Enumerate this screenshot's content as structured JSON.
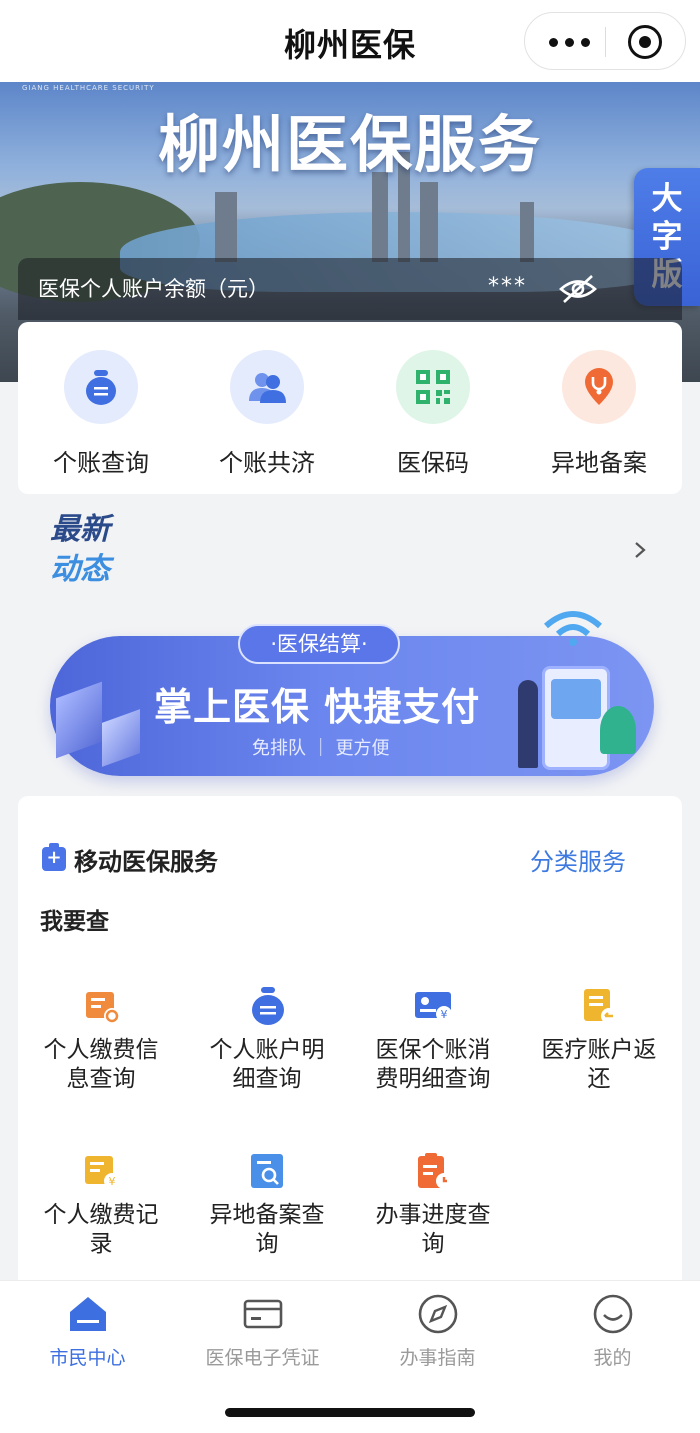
{
  "nav": {
    "title": "柳州医保"
  },
  "banner": {
    "tiny_text": "GIANG HEALTHCARE SECURITY",
    "title": "柳州医保服务",
    "big_font": [
      "大",
      "字",
      "版"
    ],
    "balance_label": "医保个人账户余额（元）",
    "balance_value": "***"
  },
  "quick_actions": [
    {
      "label": "个账查询",
      "icon": "money-bag-icon",
      "bg": "#e3ebfd",
      "color": "#3f6fe0"
    },
    {
      "label": "个账共济",
      "icon": "users-icon",
      "bg": "#e3ebfd",
      "color": "#3f6fe0"
    },
    {
      "label": "医保码",
      "icon": "qr-code-icon",
      "bg": "#dff5e8",
      "color": "#2fb26b"
    },
    {
      "label": "异地备案",
      "icon": "location-stethoscope-icon",
      "bg": "#fde8df",
      "color": "#ef6a35"
    }
  ],
  "news": {
    "line1": "最新",
    "line2": "动态"
  },
  "promo": {
    "tag": "·医保结算·",
    "headline": "掌上医保  快捷支付",
    "sub": "免排队  ｜  更方便"
  },
  "services": {
    "header": "移动医保服务",
    "category_link": "分类服务",
    "section_label": "我要查",
    "items": [
      {
        "l1": "个人缴费信",
        "l2": "息查询",
        "icon": "payment-record-icon",
        "color": "#f08a3c"
      },
      {
        "l1": "个人账户明",
        "l2": "细查询",
        "icon": "money-bag-icon",
        "color": "#3f6fe0"
      },
      {
        "l1": "医保个账消",
        "l2": "费明细查询",
        "icon": "yuan-card-icon",
        "color": "#3f6fe0"
      },
      {
        "l1": "医疗账户返",
        "l2": "还",
        "icon": "refund-doc-icon",
        "color": "#f0b52e"
      },
      {
        "l1": "个人缴费记",
        "l2": "录",
        "icon": "payment-list-icon",
        "color": "#f0b52e"
      },
      {
        "l1": "异地备案查",
        "l2": "询",
        "icon": "search-doc-icon",
        "color": "#4a90e8"
      },
      {
        "l1": "办事进度查",
        "l2": "询",
        "icon": "progress-clock-icon",
        "color": "#ef6a35"
      }
    ]
  },
  "tabbar": [
    {
      "label": "市民中心",
      "icon": "home-icon",
      "active": true
    },
    {
      "label": "医保电子凭证",
      "icon": "card-icon",
      "active": false
    },
    {
      "label": "办事指南",
      "icon": "compass-icon",
      "active": false
    },
    {
      "label": "我的",
      "icon": "smile-icon",
      "active": false
    }
  ],
  "colors": {
    "accent": "#3d6fe0",
    "promo": "#5a76e8"
  }
}
